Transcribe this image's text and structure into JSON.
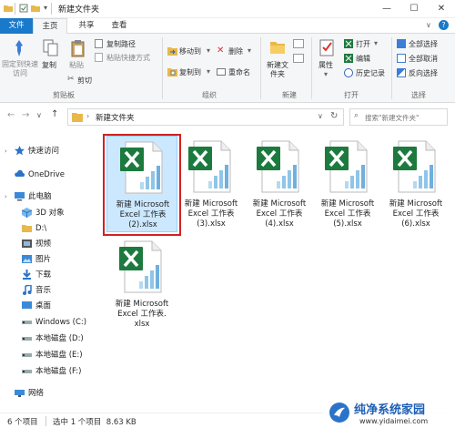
{
  "window": {
    "title": "新建文件夹",
    "controls": {
      "minimize": "—",
      "maximize": "☐",
      "close": "✕"
    }
  },
  "tabs": [
    "文件",
    "主页",
    "共享",
    "查看"
  ],
  "ribbon": {
    "clipboard": {
      "pin": "固定到快速访问",
      "copy": "复制",
      "paste": "粘贴",
      "copy_path": "复制路径",
      "paste_shortcut": "粘贴快捷方式",
      "cut": "剪切",
      "group": "剪贴板"
    },
    "organize": {
      "move_to": "移动到",
      "copy_to": "复制到",
      "delete": "删除",
      "rename": "重命名",
      "group": "组织"
    },
    "new": {
      "new_folder": "新建文件夹",
      "group": "新建"
    },
    "open": {
      "properties": "属性",
      "open": "打开",
      "edit": "编辑",
      "history": "历史记录",
      "group": "打开"
    },
    "select": {
      "select_all": "全部选择",
      "select_none": "全部取消",
      "invert": "反向选择",
      "group": "选择"
    }
  },
  "address": {
    "path": "新建文件夹",
    "search_placeholder": "搜索\"新建文件夹\""
  },
  "nav": [
    {
      "label": "快速访问",
      "icon": "star-icon",
      "level": 0
    },
    {
      "label": "OneDrive",
      "icon": "cloud-icon",
      "level": 0
    },
    {
      "label": "此电脑",
      "icon": "computer-icon",
      "level": 0
    },
    {
      "label": "3D 对象",
      "icon": "cube-icon",
      "level": 1
    },
    {
      "label": "D:\\",
      "icon": "folder-icon",
      "level": 1
    },
    {
      "label": "视频",
      "icon": "video-icon",
      "level": 1
    },
    {
      "label": "图片",
      "icon": "picture-icon",
      "level": 1
    },
    {
      "label": "下载",
      "icon": "download-icon",
      "level": 1
    },
    {
      "label": "音乐",
      "icon": "music-icon",
      "level": 1
    },
    {
      "label": "桌面",
      "icon": "desktop-icon",
      "level": 1
    },
    {
      "label": "Windows (C:)",
      "icon": "drive-icon",
      "level": 1
    },
    {
      "label": "本地磁盘 (D:)",
      "icon": "drive-icon",
      "level": 1
    },
    {
      "label": "本地磁盘 (E:)",
      "icon": "drive-icon",
      "level": 1
    },
    {
      "label": "本地磁盘 (F:)",
      "icon": "drive-icon",
      "level": 1
    },
    {
      "label": "网络",
      "icon": "network-icon",
      "level": 0
    }
  ],
  "files": [
    {
      "name_lines": [
        "新建 Microsoft",
        "Excel 工作表",
        "(2).xlsx"
      ],
      "selected": true
    },
    {
      "name_lines": [
        "新建 Microsoft",
        "Excel 工作表",
        "(3).xlsx"
      ],
      "selected": false
    },
    {
      "name_lines": [
        "新建 Microsoft",
        "Excel 工作表",
        "(4).xlsx"
      ],
      "selected": false
    },
    {
      "name_lines": [
        "新建 Microsoft",
        "Excel 工作表",
        "(5).xlsx"
      ],
      "selected": false
    },
    {
      "name_lines": [
        "新建 Microsoft",
        "Excel 工作表",
        "(6).xlsx"
      ],
      "selected": false
    },
    {
      "name_lines": [
        "新建 Microsoft",
        "Excel 工作表.",
        "xlsx"
      ],
      "selected": false
    }
  ],
  "status": {
    "count": "6 个项目",
    "selection": "选中 1 个项目  8.63 KB"
  },
  "watermark": {
    "brand": "纯净系统家园",
    "url": "www.yidaimei.com"
  },
  "colors": {
    "accent": "#1979ca",
    "selection": "#cce8ff",
    "highlight_border": "#d32020",
    "excel_green": "#1d7a3f"
  }
}
